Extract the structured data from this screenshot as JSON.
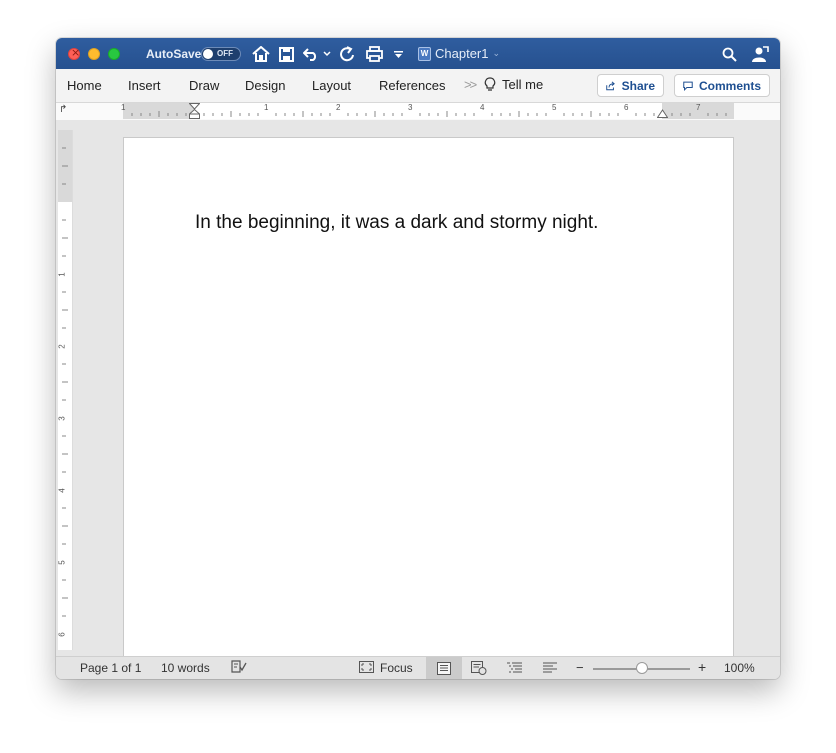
{
  "titlebar": {
    "autosave_label": "AutoSave",
    "autosave_state": "OFF",
    "doc_title": "Chapter1",
    "doc_badge": "W"
  },
  "ribbon": {
    "tabs": [
      "Home",
      "Insert",
      "Draw",
      "Design",
      "Layout",
      "References"
    ],
    "more": ">>",
    "tell_me": "Tell me",
    "share_label": "Share",
    "comments_label": "Comments"
  },
  "ruler": {
    "numbers": [
      "1",
      "1",
      "2",
      "3",
      "4",
      "5",
      "6",
      "7"
    ],
    "vertical_numbers": [
      "1",
      "2",
      "3",
      "4",
      "5",
      "6"
    ]
  },
  "document": {
    "body_text": "In the beginning, it was a dark and stormy night."
  },
  "status": {
    "page": "Page 1 of 1",
    "words": "10 words",
    "focus": "Focus",
    "zoom": "100%",
    "zoom_minus": "−",
    "zoom_plus": "+"
  },
  "colors": {
    "titlebar": "#2b5797",
    "accent_text": "#1e4f91"
  }
}
